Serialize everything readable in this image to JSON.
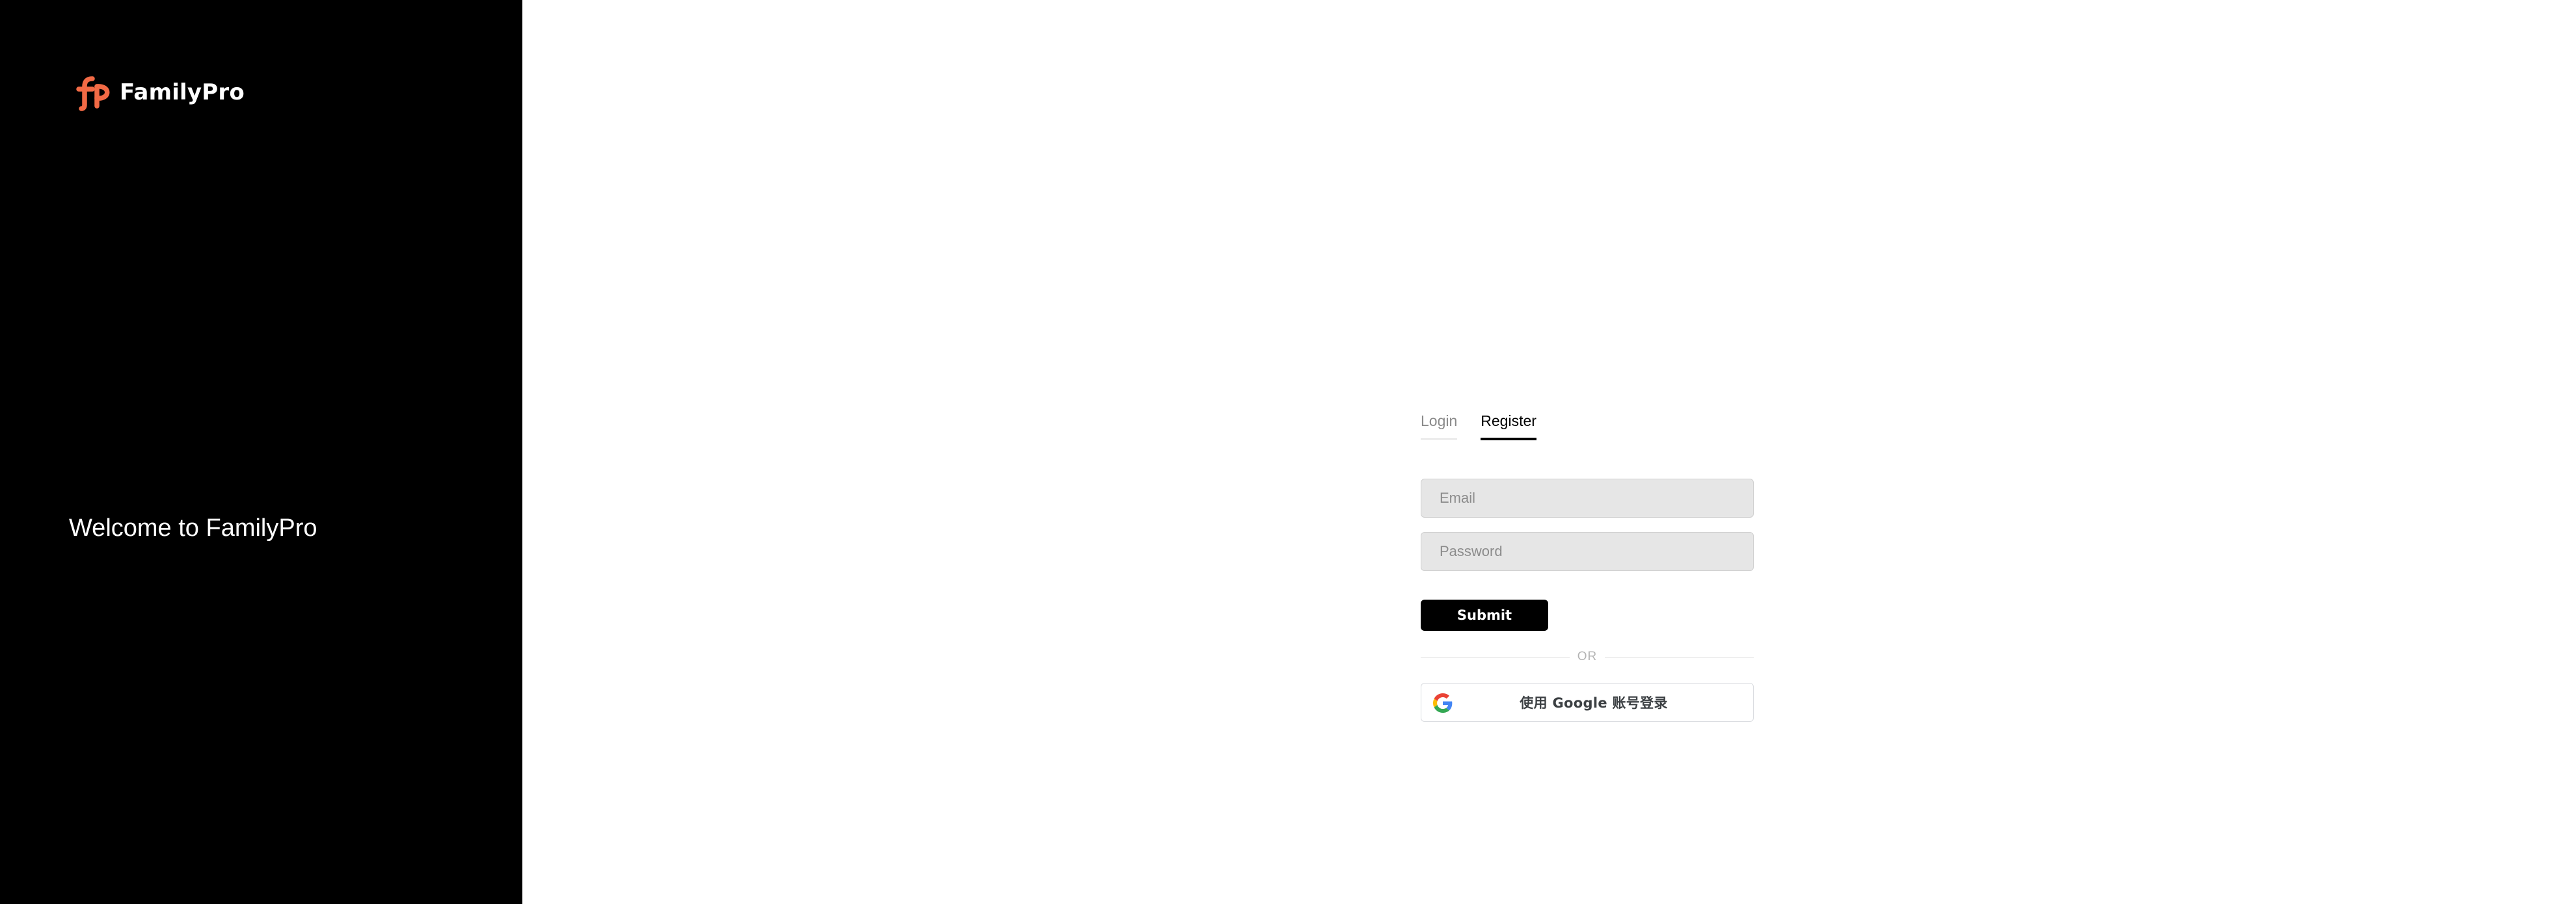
{
  "brand": {
    "name": "FamilyPro",
    "logo_icon": "familypro-logo-icon",
    "accent_color": "#F26A45"
  },
  "sidebar": {
    "background_color": "#000000",
    "welcome_text": "Welcome to FamilyPro"
  },
  "auth": {
    "tabs": [
      {
        "label": "Login",
        "active": false
      },
      {
        "label": "Register",
        "active": true
      }
    ],
    "email_placeholder": "Email",
    "password_placeholder": "Password",
    "submit_label": "Submit",
    "divider_text": "OR",
    "google_button_label": "使用 Google 账号登录",
    "google_icon": "google-g-icon"
  }
}
